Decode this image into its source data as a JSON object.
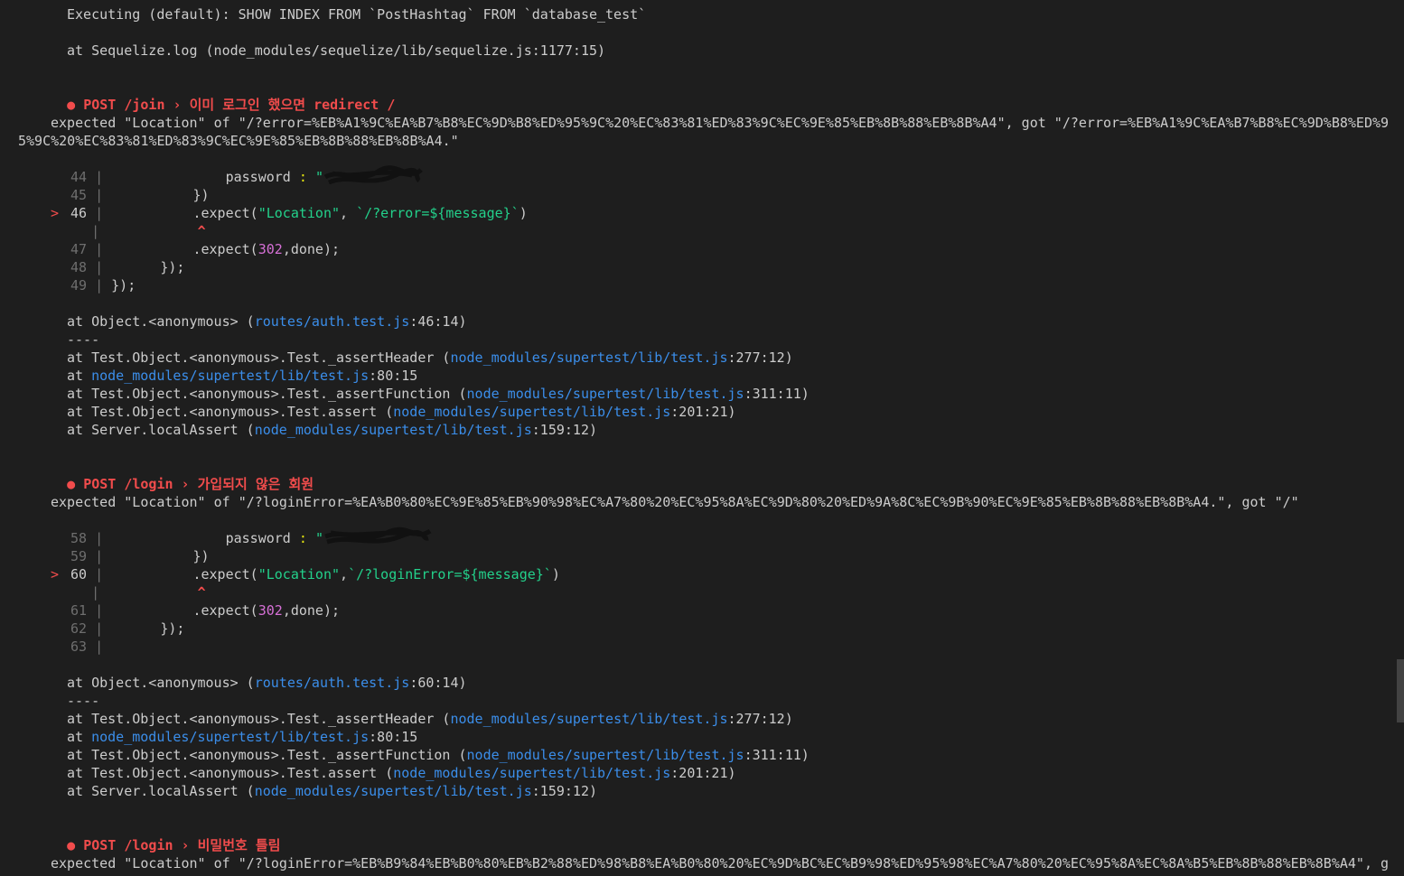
{
  "terminal": {
    "executing": "Executing (default): SHOW INDEX FROM `PostHashtag` FROM `database_test`",
    "sequelize_at": "at Sequelize.log (node_modules/sequelize/lib/sequelize.js:1177:15)",
    "bullet": "●",
    "failures": [
      {
        "title": "POST /join › 이미 로그인 했으면 redirect /",
        "expected": "expected \"Location\" of \"/?error=%EB%A1%9C%EA%B7%B8%EC%9D%B8%ED%95%9C%20%EC%83%81%ED%83%9C%EC%9E%85%EB%8B%88%EB%8B%A4\", got \"/?error=%EB%A1%9C%EA%B7%B8%EC%9D%B8%ED%95%9C%20%EC%83%81%ED%83%9C%EC%9E%85%EB%8B%88%EB%8B%A4.\"",
        "code": {
          "l44": "44",
          "password_key": "password",
          "colon": ":",
          "quote": "\"",
          "l45": "45",
          "close_obj": "})",
          "l46": "46",
          "expect_open": ".expect(",
          "location_str": "\"Location\"",
          "comma": ", ",
          "template_str": "`/?error=${message}`",
          "close_paren": ")",
          "caret": "^",
          "l47": "47",
          "expect2_open": ".expect(",
          "status": "302",
          "done_tail": ",done);",
          "l48": "48",
          "close_inner": "});",
          "l49": "49",
          "close_outer": "});"
        },
        "stack": {
          "anon_prefix": "at Object.<anonymous> (",
          "anon_file": "routes/auth.test.js",
          "anon_loc": ":46:14)",
          "sep": "----",
          "s1_prefix": "at Test.Object.<anonymous>.Test._assertHeader (",
          "s1_loc": ":277:12)",
          "s2_prefix": "at ",
          "s2_loc": ":80:15",
          "s3_prefix": "at Test.Object.<anonymous>.Test._assertFunction (",
          "s3_loc": ":311:11)",
          "s4_prefix": "at Test.Object.<anonymous>.Test.assert (",
          "s4_loc": ":201:21)",
          "s5_prefix": "at Server.localAssert (",
          "s5_loc": ":159:12)",
          "file": "node_modules/supertest/lib/test.js"
        }
      },
      {
        "title": "POST /login › 가입되지 않은 회원",
        "expected": "expected \"Location\" of \"/?loginError=%EA%B0%80%EC%9E%85%EB%90%98%EC%A7%80%20%EC%95%8A%EC%9D%80%20%ED%9A%8C%EC%9B%90%EC%9E%85%EB%8B%88%EB%8B%A4.\", got \"/\"",
        "code": {
          "l58": "58",
          "password_key": "password",
          "colon": ":",
          "quote": "\"",
          "l59": "59",
          "close_obj": "})",
          "l60": "60",
          "expect_open": ".expect(",
          "location_str": "\"Location\"",
          "comma": ",",
          "template_str": "`/?loginError=${message}`",
          "close_paren": ")",
          "caret": "^",
          "l61": "61",
          "expect2_open": ".expect(",
          "status": "302",
          "done_tail": ",done);",
          "l62": "62",
          "close_inner": "});",
          "l63": "63"
        },
        "stack": {
          "anon_prefix": "at Object.<anonymous> (",
          "anon_file": "routes/auth.test.js",
          "anon_loc": ":60:14)",
          "sep": "----",
          "s1_prefix": "at Test.Object.<anonymous>.Test._assertHeader (",
          "s1_loc": ":277:12)",
          "s2_prefix": "at ",
          "s2_loc": ":80:15",
          "s3_prefix": "at Test.Object.<anonymous>.Test._assertFunction (",
          "s3_loc": ":311:11)",
          "s4_prefix": "at Test.Object.<anonymous>.Test.assert (",
          "s4_loc": ":201:21)",
          "s5_prefix": "at Server.localAssert (",
          "s5_loc": ":159:12)",
          "file": "node_modules/supertest/lib/test.js"
        }
      },
      {
        "title": "POST /login › 비밀번호 틀림",
        "expected": "expected \"Location\" of \"/?loginError=%EB%B9%84%EB%B0%80%EB%B2%88%ED%98%B8%EA%B0%80%20%EC%9D%BC%EC%B9%98%ED%95%98%EC%A7%80%20%EC%95%8A%EC%8A%B5%EB%8B%88%EB%8B%A4\", g"
      }
    ],
    "marker": ">",
    "gutter": "|",
    "colors": {
      "background": "#1e1e1e",
      "fail": "#f14c4c",
      "link": "#3b8eea",
      "string": "#23d18b",
      "number": "#d670d6"
    }
  }
}
